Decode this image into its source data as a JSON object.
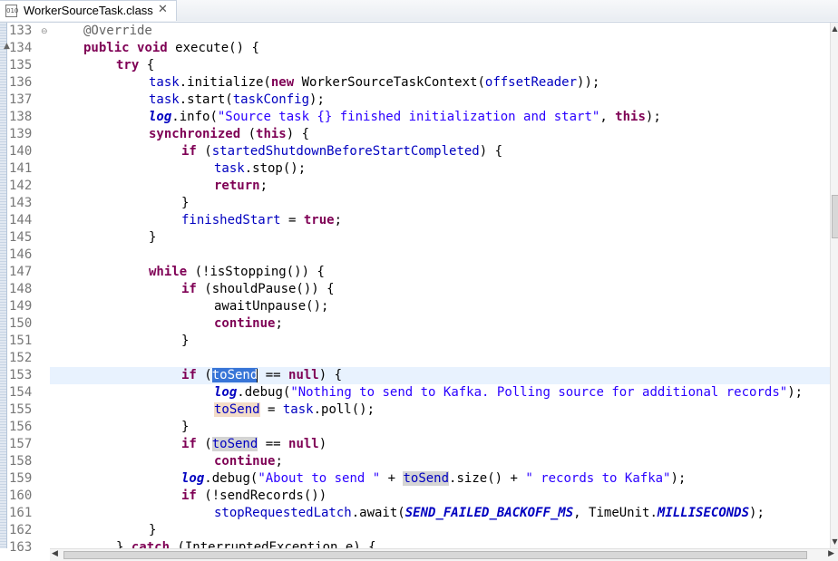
{
  "tab": {
    "title": "WorkerSourceTask.class",
    "close": "✕",
    "icon": "class-file-icon"
  },
  "line_numbers": [
    "133",
    "134",
    "135",
    "136",
    "137",
    "138",
    "139",
    "140",
    "141",
    "142",
    "143",
    "144",
    "145",
    "146",
    "147",
    "148",
    "149",
    "150",
    "151",
    "152",
    "153",
    "154",
    "155",
    "156",
    "157",
    "158",
    "159",
    "160",
    "161",
    "162",
    "163"
  ],
  "code": {
    "l133_ann": "@Override",
    "l134_kw1": "public",
    "l134_kw2": "void",
    "l134_rest": " execute() {",
    "l135_kw": "try",
    "l135_rest": " {",
    "l136_a": "task",
    "l136_b": ".initialize(",
    "l136_kw": "new",
    "l136_c": " WorkerSourceTaskContext(",
    "l136_d": "offsetReader",
    "l136_e": "));",
    "l137_a": "task",
    "l137_b": ".start(",
    "l137_c": "taskConfig",
    "l137_d": ");",
    "l138_a": "log",
    "l138_b": ".info(",
    "l138_str": "\"Source task {} finished initialization and start\"",
    "l138_c": ", ",
    "l138_kw": "this",
    "l138_d": ");",
    "l139_kw1": "synchronized",
    "l139_b": " (",
    "l139_kw2": "this",
    "l139_c": ") {",
    "l140_kw": "if",
    "l140_b": " (",
    "l140_c": "startedShutdownBeforeStartCompleted",
    "l140_d": ") {",
    "l141_a": "task",
    "l141_b": ".stop();",
    "l142_kw": "return",
    "l142_b": ";",
    "l143_a": "}",
    "l144_a": "finishedStart",
    "l144_b": " = ",
    "l144_kw": "true",
    "l144_c": ";",
    "l145_a": "}",
    "l147_kw": "while",
    "l147_b": " (!isStopping()) {",
    "l148_kw": "if",
    "l148_b": " (shouldPause()) {",
    "l149_a": "awaitUnpause();",
    "l150_kw": "continue",
    "l150_b": ";",
    "l151_a": "}",
    "l153_kw": "if",
    "l153_b": " (",
    "l153_sel": "toSend",
    "l153_c": " == ",
    "l153_kw2": "null",
    "l153_d": ") {",
    "l154_a": "log",
    "l154_b": ".debug(",
    "l154_str": "\"Nothing to send to Kafka. Polling source for additional records\"",
    "l154_c": ");",
    "l155_a": "toSend",
    "l155_b": " = ",
    "l155_c": "task",
    "l155_d": ".poll();",
    "l156_a": "}",
    "l157_kw": "if",
    "l157_b": " (",
    "l157_c": "toSend",
    "l157_d": " == ",
    "l157_kw2": "null",
    "l157_e": ")",
    "l158_kw": "continue",
    "l158_b": ";",
    "l159_a": "log",
    "l159_b": ".debug(",
    "l159_str1": "\"About to send \"",
    "l159_c": " + ",
    "l159_d": "toSend",
    "l159_e": ".size() + ",
    "l159_str2": "\" records to Kafka\"",
    "l159_f": ");",
    "l160_kw": "if",
    "l160_b": " (!sendRecords())",
    "l161_a": "stopRequestedLatch",
    "l161_b": ".await(",
    "l161_c": "SEND_FAILED_BACKOFF_MS",
    "l161_d": ", TimeUnit.",
    "l161_e": "MILLISECONDS",
    "l161_f": ");",
    "l162_a": "}",
    "l163_a": "} ",
    "l163_kw": "catch",
    "l163_b": " (InterruptedException e) {"
  },
  "colors": {
    "keyword": "#7f0055",
    "field": "#0000c0",
    "string": "#2a00ff",
    "annotation": "#646464",
    "selection": "#3875d7",
    "current_line": "#e8f2fe"
  }
}
